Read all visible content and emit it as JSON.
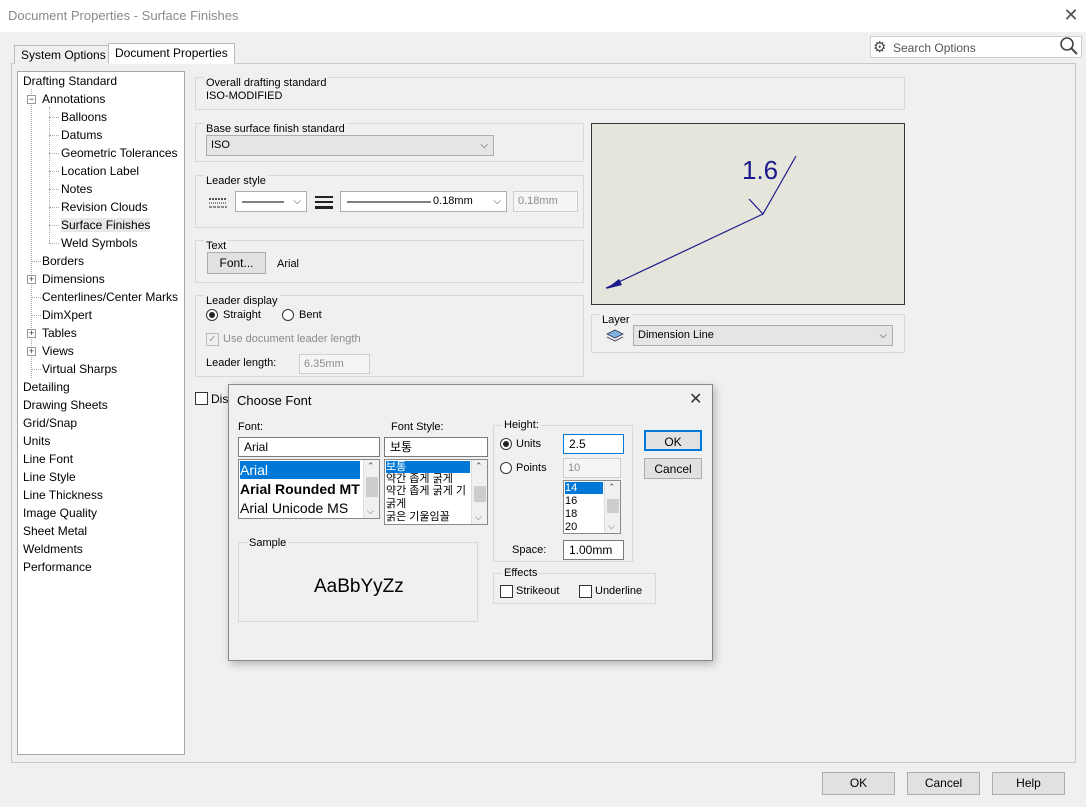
{
  "window": {
    "title": "Document Properties - Surface Finishes",
    "close_glyph": "✕"
  },
  "tabs": [
    {
      "label": "System Options"
    },
    {
      "label": "Document Properties"
    }
  ],
  "search": {
    "placeholder": "Search Options"
  },
  "tree": [
    {
      "label": "Drafting Standard"
    },
    {
      "label": "Annotations"
    },
    {
      "label": "Balloons"
    },
    {
      "label": "Datums"
    },
    {
      "label": "Geometric Tolerances"
    },
    {
      "label": "Location Label"
    },
    {
      "label": "Notes"
    },
    {
      "label": "Revision Clouds"
    },
    {
      "label": "Surface Finishes"
    },
    {
      "label": "Weld Symbols"
    },
    {
      "label": "Borders"
    },
    {
      "label": "Dimensions"
    },
    {
      "label": "Centerlines/Center Marks"
    },
    {
      "label": "DimXpert"
    },
    {
      "label": "Tables"
    },
    {
      "label": "Views"
    },
    {
      "label": "Virtual Sharps"
    },
    {
      "label": "Detailing"
    },
    {
      "label": "Drawing Sheets"
    },
    {
      "label": "Grid/Snap"
    },
    {
      "label": "Units"
    },
    {
      "label": "Line Font"
    },
    {
      "label": "Line Style"
    },
    {
      "label": "Line Thickness"
    },
    {
      "label": "Image Quality"
    },
    {
      "label": "Sheet Metal"
    },
    {
      "label": "Weldments"
    },
    {
      "label": "Performance"
    }
  ],
  "overall": {
    "title": "Overall drafting standard",
    "value": "ISO-MODIFIED"
  },
  "base_standard": {
    "title": "Base surface finish standard",
    "value": "ISO"
  },
  "leader_style": {
    "title": "Leader style",
    "thickness_value": "0.18mm",
    "custom_thickness": "0.18mm"
  },
  "text_group": {
    "title": "Text",
    "font_button": "Font...",
    "font_name": "Arial"
  },
  "leader_display": {
    "title": "Leader display",
    "straight": "Straight",
    "bent": "Bent",
    "use_doc_length": "Use document leader length",
    "length_label": "Leader length:",
    "length_value": "6.35mm"
  },
  "display_check": {
    "label": "Disp"
  },
  "preview": {
    "value_label": "1.6"
  },
  "layer": {
    "title": "Layer",
    "value": "Dimension Line"
  },
  "choose_font": {
    "title": "Choose Font",
    "font_label": "Font:",
    "font_value": "Arial",
    "fonts": [
      "Arial",
      "Arial Rounded MT",
      "Arial Unicode MS"
    ],
    "style_label": "Font Style:",
    "style_value": "보통",
    "styles": [
      "보통",
      "약간 좁게 굵게",
      "약간 좁게 굵게 기",
      "굵게",
      "굵은 기울임꼴"
    ],
    "height_label": "Height:",
    "units_label": "Units",
    "units_value": "2.5",
    "points_label": "Points",
    "points_value": "10",
    "point_sizes": [
      "14",
      "16",
      "18",
      "20"
    ],
    "space_label": "Space:",
    "space_value": "1.00mm",
    "ok": "OK",
    "cancel": "Cancel",
    "sample_title": "Sample",
    "sample_text": "AaBbYyZz",
    "effects_title": "Effects",
    "strikeout": "Strikeout",
    "underline": "Underline"
  },
  "footer": {
    "ok": "OK",
    "cancel": "Cancel",
    "help": "Help"
  }
}
